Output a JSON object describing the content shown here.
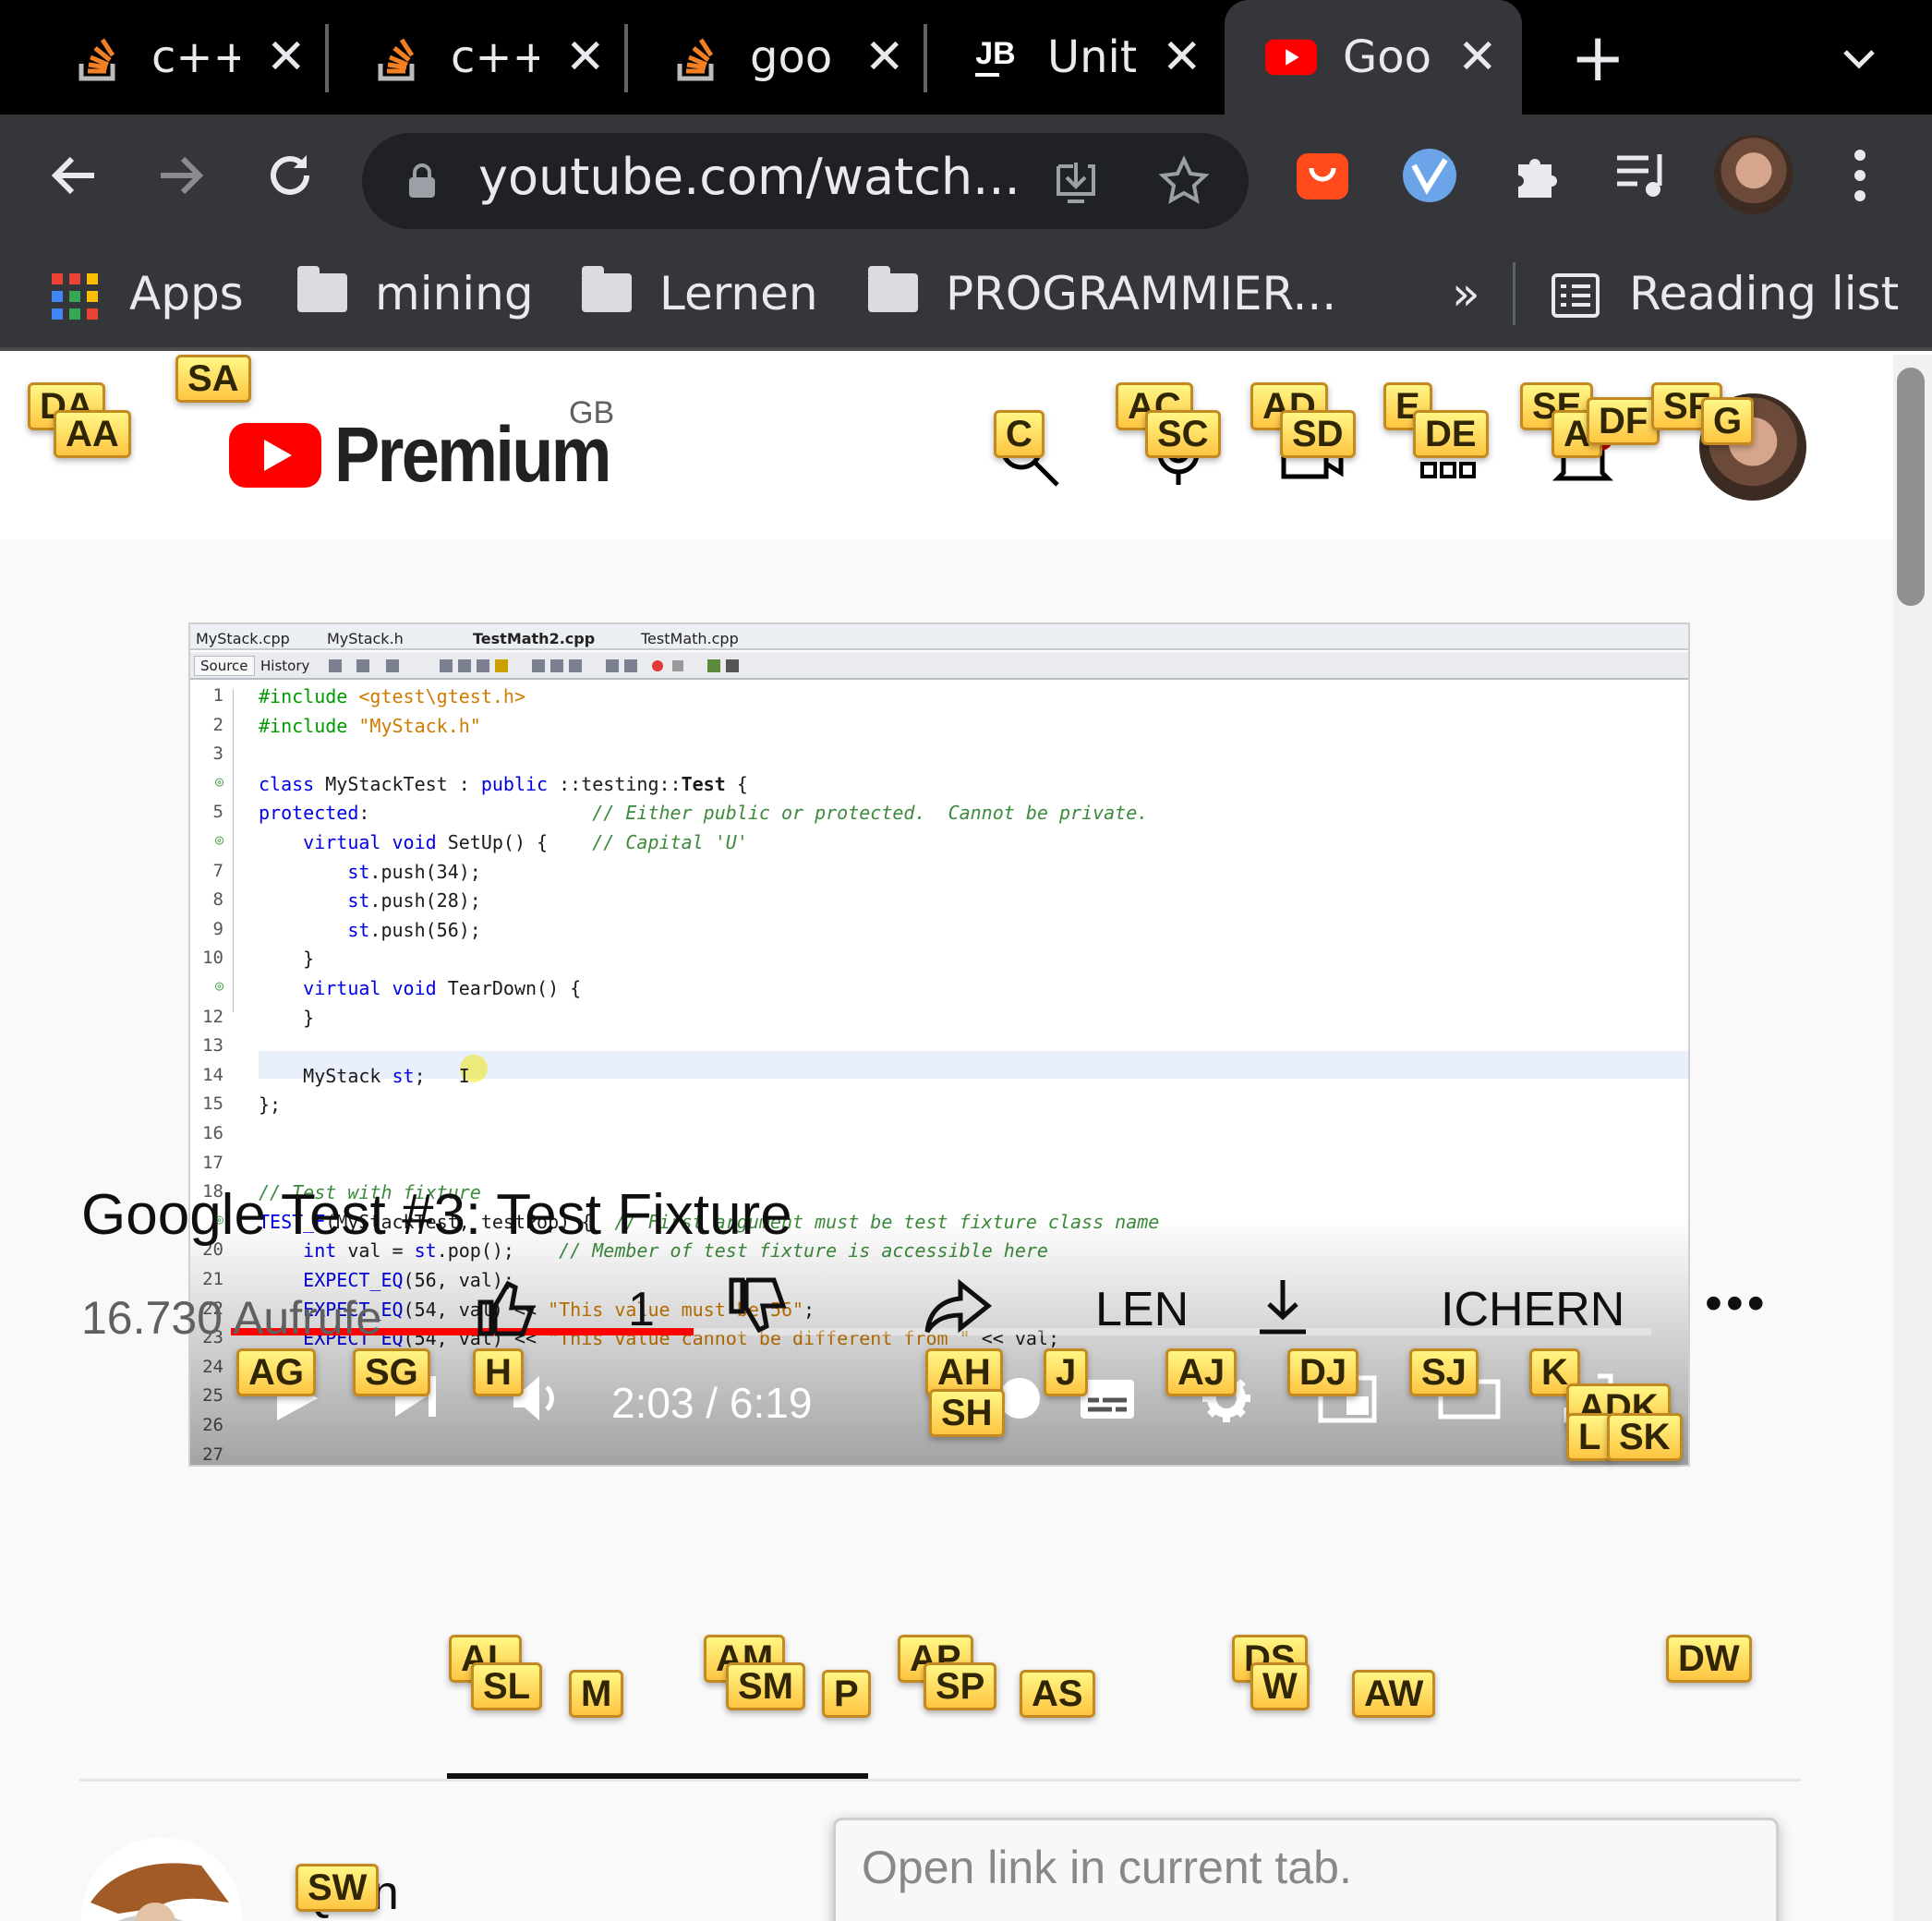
{
  "tabs": [
    {
      "label": "c++",
      "icon": "stackoverflow-icon"
    },
    {
      "label": "c++",
      "icon": "stackoverflow-icon"
    },
    {
      "label": "goo",
      "icon": "stackoverflow-icon"
    },
    {
      "label": "Unit",
      "icon": "jetbrains-icon",
      "icon_text": "JB"
    },
    {
      "label": "Goo",
      "icon": "youtube-icon",
      "active": true
    }
  ],
  "address_bar": {
    "url": "youtube.com/watch..."
  },
  "bookmarks": {
    "apps": "Apps",
    "items": [
      "mining",
      "Lernen",
      "PROGRAMMIER..."
    ],
    "overflow": "»",
    "reading_list": "Reading list"
  },
  "youtube": {
    "logo_text": "Premium",
    "region": "GB"
  },
  "ide": {
    "tabs": [
      "MyStack.cpp",
      "MyStack.h",
      "TestMath2.cpp",
      "TestMath.cpp"
    ],
    "source_tab": "Source",
    "history_tab": "History",
    "code_lines": [
      {
        "n": "1",
        "html": "<span class='pp'>#include</span> <span class='st'>&lt;gtest\\gtest.h&gt;</span>"
      },
      {
        "n": "2",
        "html": "<span class='pp'>#include</span> <span class='st'>\"MyStack.h\"</span>"
      },
      {
        "n": "3",
        "html": ""
      },
      {
        "n": "",
        "html": "<span class='kw'>class</span> MyStackTest : <span class='kw'>public</span> ::testing::<b>Test</b> {"
      },
      {
        "n": "5",
        "html": "<span class='kw'>protected</span>:                    <span class='cm2'>// Either public or protected.  Cannot be private.</span>"
      },
      {
        "n": "",
        "html": "    <span class='kw'>virtual void</span> SetUp() {    <span class='cm2'>// Capital 'U'</span>"
      },
      {
        "n": "7",
        "html": "        <span class='kw'>st</span>.push(34);"
      },
      {
        "n": "8",
        "html": "        <span class='kw'>st</span>.push(28);"
      },
      {
        "n": "9",
        "html": "        <span class='kw'>st</span>.push(56);"
      },
      {
        "n": "10",
        "html": "    }"
      },
      {
        "n": "",
        "html": "    <span class='kw'>virtual void</span> TearDown() {"
      },
      {
        "n": "12",
        "html": "    }"
      },
      {
        "n": "13",
        "html": ""
      },
      {
        "n": "14",
        "html": "    MyStack <span class='kw'>st</span>;   𝙸"
      },
      {
        "n": "15",
        "html": "};"
      },
      {
        "n": "16",
        "html": ""
      },
      {
        "n": "17",
        "html": ""
      },
      {
        "n": "18",
        "html": "<span class='cm2'>// Test with fixture</span>"
      },
      {
        "n": "",
        "html": "<span class='kw'>TEST_F</span>(MyStackTest, testPop) {  <span class='cm2'>// First argument must be test fixture class name</span>"
      },
      {
        "n": "20",
        "html": "    <span class='kw'>int</span> val = <span class='kw'>st</span>.pop();    <span class='cm2'>// Member of test fixture is accessible here</span>"
      },
      {
        "n": "21",
        "html": "    <span class='kw'>EXPECT_EQ</span>(56, val);"
      },
      {
        "n": "22",
        "html": "    <span class='kw'>EXPECT_EQ</span>(54, val) &lt;&lt; <span class='st'>\"This value must be 56\"</span>;"
      },
      {
        "n": "23",
        "html": "    <span class='kw'>EXPECT_EQ</span>(54, val) &lt;&lt; <span class='st'>\"This value cannot be different from \"</span> &lt;&lt; val;"
      },
      {
        "n": "24",
        "html": ""
      },
      {
        "n": "25",
        "html": ""
      },
      {
        "n": "26",
        "html": ""
      },
      {
        "n": "27",
        "html": ""
      }
    ]
  },
  "player": {
    "time": "2:03 / 6:19",
    "progress": 0.326
  },
  "video": {
    "title": "Google Test #3: Test Fixture",
    "views": "16.730 Aufrufe",
    "like_count": "1",
    "share_fragment": "LEN",
    "save_fragment": "ICHERN",
    "more": "•••"
  },
  "channel": {
    "name_fragment": "Qian"
  },
  "tooltip": "Open link in current tab.",
  "hints": [
    "DA",
    "AA",
    "SA",
    "C",
    "AC",
    "SC",
    "AD",
    "SD",
    "E",
    "DE",
    "SE",
    "A",
    "DF",
    "SF",
    "G",
    "AG",
    "SG",
    "H",
    "AH",
    "SH",
    "J",
    "AJ",
    "DJ",
    "SJ",
    "K",
    "ADK",
    "L",
    "SK",
    "AL",
    "SL",
    "M",
    "AM",
    "SM",
    "P",
    "AP",
    "SP",
    "AS",
    "DS",
    "W",
    "AW",
    "DW",
    "SW"
  ],
  "colors": {
    "tab_bg": "#000000",
    "toolbar_bg": "#35363a",
    "youtube_red": "#ff0000",
    "hint_yellow": "#ffc542"
  }
}
